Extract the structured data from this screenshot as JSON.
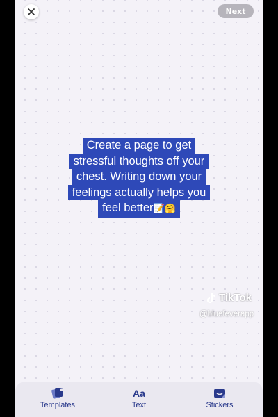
{
  "header": {
    "next_label": "Next"
  },
  "caption": {
    "lines": [
      "Create a page to get",
      "stressful thoughts off your",
      "chest. Writing down your",
      "feelings actually helps you",
      "feel better"
    ],
    "emojis": "📝🤗"
  },
  "watermark": {
    "brand": "TikTok",
    "handle": "@bluefeverapp"
  },
  "toolbar": {
    "items": [
      {
        "label": "Templates",
        "icon": "templates-icon"
      },
      {
        "label": "Text",
        "icon_text": "Aa"
      },
      {
        "label": "Stickers",
        "icon": "stickers-icon"
      }
    ]
  },
  "colors": {
    "caption_bg": "#2e49b8",
    "toolbar_accent": "#2a3a8c",
    "next_button_bg": "#b6b4bb"
  }
}
